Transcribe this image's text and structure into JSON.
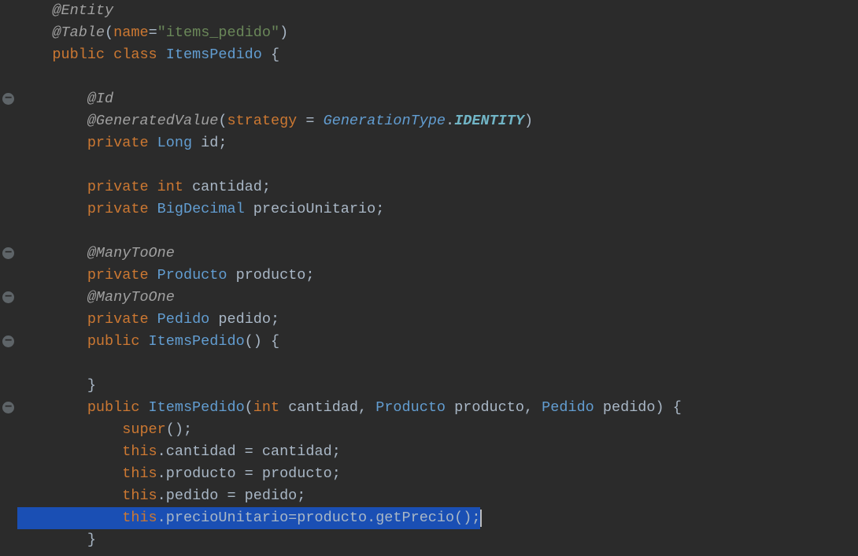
{
  "indent": "    ",
  "lines": [
    {
      "fold": false,
      "tokens": [
        {
          "t": "    ",
          "c": "c-default"
        },
        {
          "t": "@Entity",
          "c": "c-annot"
        }
      ]
    },
    {
      "fold": false,
      "tokens": [
        {
          "t": "    ",
          "c": "c-default"
        },
        {
          "t": "@Table",
          "c": "c-annot"
        },
        {
          "t": "(",
          "c": "c-default"
        },
        {
          "t": "name",
          "c": "c-param"
        },
        {
          "t": "=",
          "c": "c-default"
        },
        {
          "t": "\"items_pedido\"",
          "c": "c-string"
        },
        {
          "t": ")",
          "c": "c-default"
        }
      ]
    },
    {
      "fold": false,
      "tokens": [
        {
          "t": "    ",
          "c": "c-default"
        },
        {
          "t": "public class ",
          "c": "c-keyword"
        },
        {
          "t": "ItemsPedido",
          "c": "c-type"
        },
        {
          "t": " {",
          "c": "c-default"
        }
      ]
    },
    {
      "fold": false,
      "tokens": [
        {
          "t": " ",
          "c": "c-default"
        }
      ]
    },
    {
      "fold": true,
      "tokens": [
        {
          "t": "        ",
          "c": "c-default"
        },
        {
          "t": "@Id",
          "c": "c-annot"
        }
      ]
    },
    {
      "fold": false,
      "tokens": [
        {
          "t": "        ",
          "c": "c-default"
        },
        {
          "t": "@GeneratedValue",
          "c": "c-annot"
        },
        {
          "t": "(",
          "c": "c-default"
        },
        {
          "t": "strategy",
          "c": "c-param"
        },
        {
          "t": " = ",
          "c": "c-default"
        },
        {
          "t": "GenerationType",
          "c": "c-typeital"
        },
        {
          "t": ".",
          "c": "c-default"
        },
        {
          "t": "IDENTITY",
          "c": "c-static"
        },
        {
          "t": ")",
          "c": "c-default"
        }
      ]
    },
    {
      "fold": false,
      "tokens": [
        {
          "t": "        ",
          "c": "c-default"
        },
        {
          "t": "private ",
          "c": "c-keyword"
        },
        {
          "t": "Long",
          "c": "c-type"
        },
        {
          "t": " id;",
          "c": "c-default"
        }
      ]
    },
    {
      "fold": false,
      "tokens": [
        {
          "t": " ",
          "c": "c-default"
        }
      ]
    },
    {
      "fold": false,
      "tokens": [
        {
          "t": "        ",
          "c": "c-default"
        },
        {
          "t": "private int ",
          "c": "c-keyword"
        },
        {
          "t": "cantidad;",
          "c": "c-default"
        }
      ]
    },
    {
      "fold": false,
      "tokens": [
        {
          "t": "        ",
          "c": "c-default"
        },
        {
          "t": "private ",
          "c": "c-keyword"
        },
        {
          "t": "BigDecimal",
          "c": "c-type"
        },
        {
          "t": " precioUnitario;",
          "c": "c-default"
        }
      ]
    },
    {
      "fold": false,
      "tokens": [
        {
          "t": " ",
          "c": "c-default"
        }
      ]
    },
    {
      "fold": true,
      "tokens": [
        {
          "t": "        ",
          "c": "c-default"
        },
        {
          "t": "@ManyToOne",
          "c": "c-annot"
        }
      ]
    },
    {
      "fold": false,
      "tokens": [
        {
          "t": "        ",
          "c": "c-default"
        },
        {
          "t": "private ",
          "c": "c-keyword"
        },
        {
          "t": "Producto",
          "c": "c-type"
        },
        {
          "t": " producto;",
          "c": "c-default"
        }
      ]
    },
    {
      "fold": true,
      "tokens": [
        {
          "t": "        ",
          "c": "c-default"
        },
        {
          "t": "@ManyToOne",
          "c": "c-annot"
        }
      ]
    },
    {
      "fold": false,
      "tokens": [
        {
          "t": "        ",
          "c": "c-default"
        },
        {
          "t": "private ",
          "c": "c-keyword"
        },
        {
          "t": "Pedido",
          "c": "c-type"
        },
        {
          "t": " pedido;",
          "c": "c-default"
        }
      ]
    },
    {
      "fold": true,
      "tokens": [
        {
          "t": "        ",
          "c": "c-default"
        },
        {
          "t": "public ",
          "c": "c-keyword"
        },
        {
          "t": "ItemsPedido",
          "c": "c-typemethod"
        },
        {
          "t": "() {",
          "c": "c-default"
        }
      ]
    },
    {
      "fold": false,
      "tokens": [
        {
          "t": " ",
          "c": "c-default"
        }
      ]
    },
    {
      "fold": false,
      "tokens": [
        {
          "t": "        }",
          "c": "c-default"
        }
      ]
    },
    {
      "fold": true,
      "tokens": [
        {
          "t": "        ",
          "c": "c-default"
        },
        {
          "t": "public ",
          "c": "c-keyword"
        },
        {
          "t": "ItemsPedido",
          "c": "c-typemethod"
        },
        {
          "t": "(",
          "c": "c-default"
        },
        {
          "t": "int",
          "c": "c-keyword"
        },
        {
          "t": " cantidad, ",
          "c": "c-default"
        },
        {
          "t": "Producto",
          "c": "c-type"
        },
        {
          "t": " producto, ",
          "c": "c-default"
        },
        {
          "t": "Pedido",
          "c": "c-type"
        },
        {
          "t": " pedido) {",
          "c": "c-default"
        }
      ]
    },
    {
      "fold": false,
      "tokens": [
        {
          "t": "            ",
          "c": "c-default"
        },
        {
          "t": "super",
          "c": "c-keyword"
        },
        {
          "t": "();",
          "c": "c-default"
        }
      ]
    },
    {
      "fold": false,
      "tokens": [
        {
          "t": "            ",
          "c": "c-default"
        },
        {
          "t": "this",
          "c": "c-this"
        },
        {
          "t": ".cantidad = cantidad;",
          "c": "c-default"
        }
      ]
    },
    {
      "fold": false,
      "tokens": [
        {
          "t": "            ",
          "c": "c-default"
        },
        {
          "t": "this",
          "c": "c-this"
        },
        {
          "t": ".producto = producto;",
          "c": "c-default"
        }
      ]
    },
    {
      "fold": false,
      "tokens": [
        {
          "t": "            ",
          "c": "c-default"
        },
        {
          "t": "this",
          "c": "c-this"
        },
        {
          "t": ".pedido = pedido;",
          "c": "c-default"
        }
      ]
    },
    {
      "fold": false,
      "selected": true,
      "cursorAtEnd": true,
      "tokens": [
        {
          "t": "            ",
          "c": "c-default"
        },
        {
          "t": "this",
          "c": "c-this"
        },
        {
          "t": ".precioUnitario=producto.getPrecio();",
          "c": "c-default"
        }
      ]
    },
    {
      "fold": false,
      "tokens": [
        {
          "t": "        }",
          "c": "c-default"
        }
      ]
    }
  ]
}
